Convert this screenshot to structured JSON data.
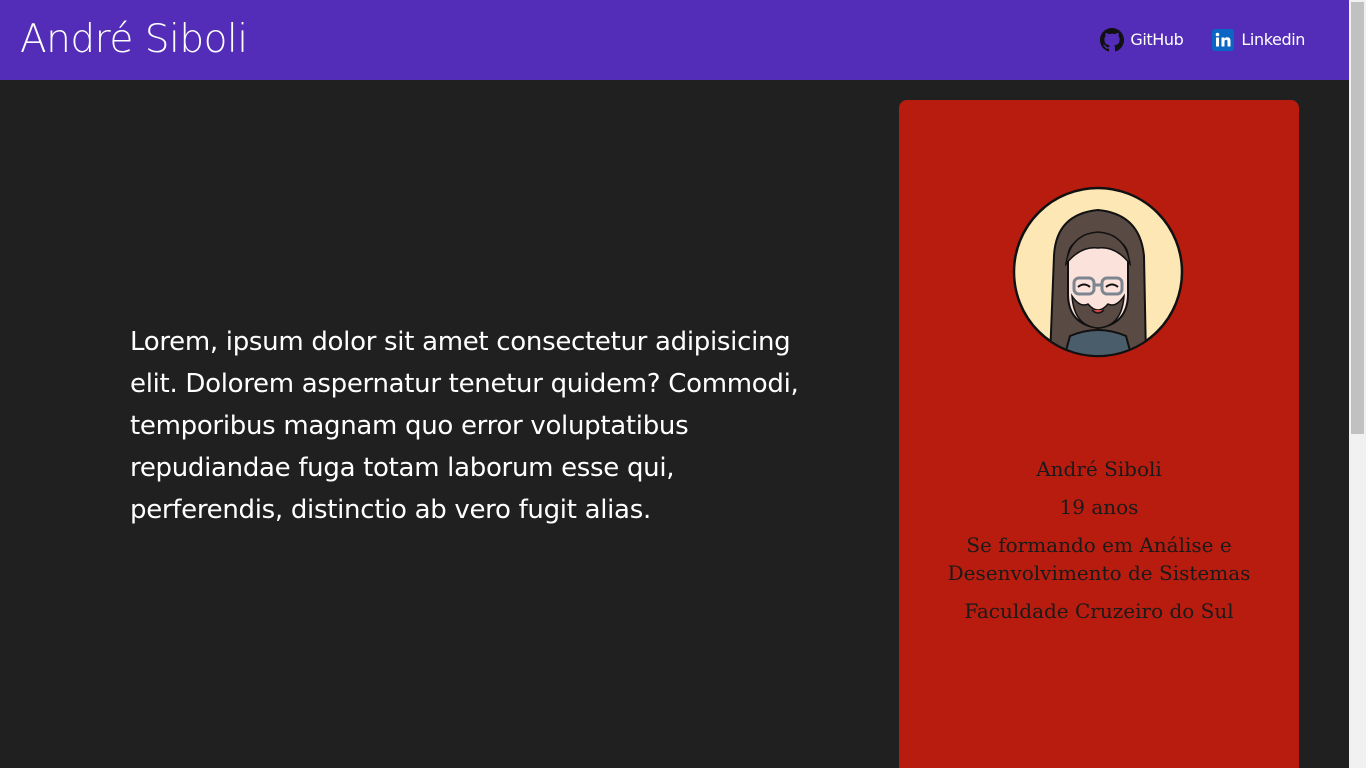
{
  "header": {
    "brand": "André Siboli",
    "links": [
      {
        "label": "GitHub",
        "icon": "github-icon"
      },
      {
        "label": "Linkedin",
        "icon": "linkedin-icon"
      }
    ]
  },
  "main": {
    "intro": "Lorem, ipsum dolor sit amet consectetur adipisicing elit. Dolorem aspernatur tenetur quidem? Commodi, temporibus magnam quo error voluptatibus repudiandae fuga totam laborum esse qui, perferendis, distinctio ab vero fugit alias."
  },
  "profile": {
    "name": "André Siboli",
    "age": "19 anos",
    "course": "Se formando em Análise e Desenvolvimento de Sistemas",
    "school": "Faculdade Cruzeiro do Sul"
  },
  "colors": {
    "header_bg": "#532db7",
    "page_bg": "#202020",
    "card_bg": "#b71c0f",
    "linkedin_blue": "#0a66c2"
  }
}
